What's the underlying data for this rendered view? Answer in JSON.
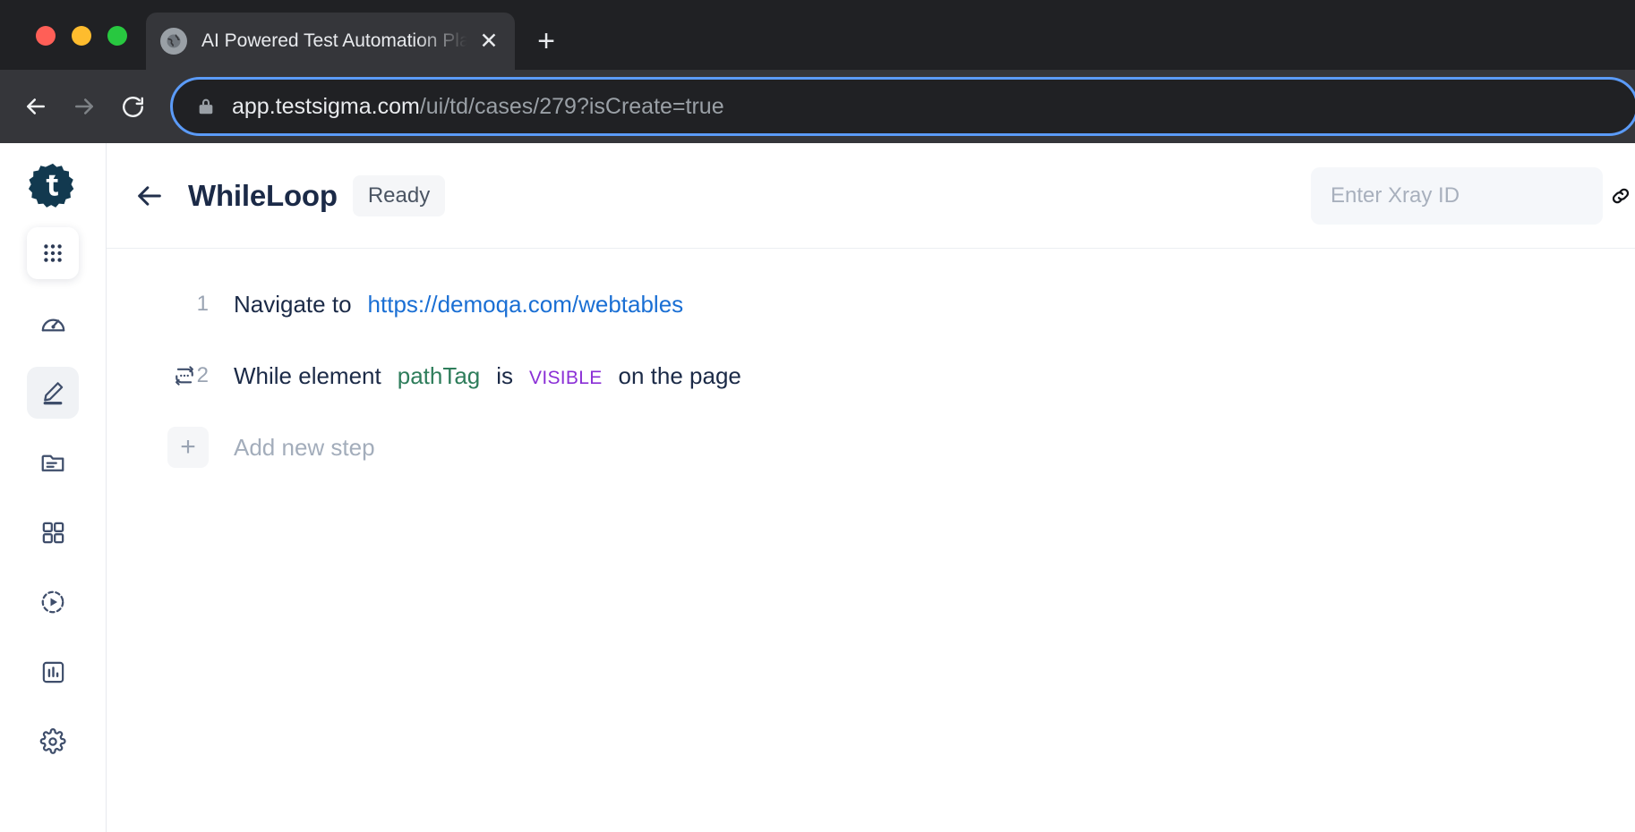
{
  "browser": {
    "tab": {
      "title": "AI Powered Test Automation Pla",
      "favicon": "globe-icon",
      "close": "✕"
    },
    "new_tab_label": "+",
    "omnibox": {
      "host": "app.testsigma.com",
      "path": "/ui/td/cases/279?isCreate=true",
      "secure_icon": "lock-icon"
    },
    "controls": {
      "back": "back-arrow-icon",
      "forward": "forward-arrow-icon",
      "reload": "reload-icon"
    },
    "accent_focus_color": "#5b9bf8",
    "chrome_bg": "#202124",
    "toolbar_bg": "#35363a"
  },
  "sidebar": {
    "logo": "testsigma-logo",
    "items": [
      {
        "name": "apps-grid",
        "icon": "grid-dots-icon",
        "state": "card"
      },
      {
        "name": "dashboard",
        "icon": "speedometer-icon",
        "state": "normal"
      },
      {
        "name": "create-tests",
        "icon": "pencil-icon",
        "state": "active"
      },
      {
        "name": "test-data",
        "icon": "folder-lines-icon",
        "state": "normal"
      },
      {
        "name": "test-suites",
        "icon": "four-squares-icon",
        "state": "normal"
      },
      {
        "name": "runs",
        "icon": "play-dashed-circle-icon",
        "state": "normal"
      },
      {
        "name": "reports",
        "icon": "bar-chart-box-icon",
        "state": "normal"
      },
      {
        "name": "settings",
        "icon": "gear-icon",
        "state": "normal"
      }
    ]
  },
  "header": {
    "back_icon": "back-arrow-icon",
    "title": "WhileLoop",
    "status": "Ready",
    "xray": {
      "placeholder": "Enter Xray ID",
      "value": "",
      "link_icon": "link-chain-icon"
    }
  },
  "steps": [
    {
      "number": "1",
      "has_loop_icon": false,
      "loop_icon": "",
      "tokens": [
        {
          "text": "Navigate to",
          "type": "plain"
        },
        {
          "text": "https://demoqa.com/webtables",
          "type": "link"
        }
      ]
    },
    {
      "number": "2",
      "has_loop_icon": true,
      "loop_icon": "loop-repeat-icon",
      "tokens": [
        {
          "text": "While element",
          "type": "plain"
        },
        {
          "text": "pathTag",
          "type": "element"
        },
        {
          "text": "is",
          "type": "plain"
        },
        {
          "text": "VISIBLE",
          "type": "state"
        },
        {
          "text": "on the page",
          "type": "plain"
        }
      ]
    }
  ],
  "add_step": {
    "plus": "+",
    "label": "Add new step"
  },
  "colors": {
    "link": "#1a6fd4",
    "element": "#2e7d5b",
    "state": "#8b2fd6",
    "title": "#1b2a47",
    "muted": "#9aa4b3",
    "sidebar_icon": "#3f4e6b"
  }
}
